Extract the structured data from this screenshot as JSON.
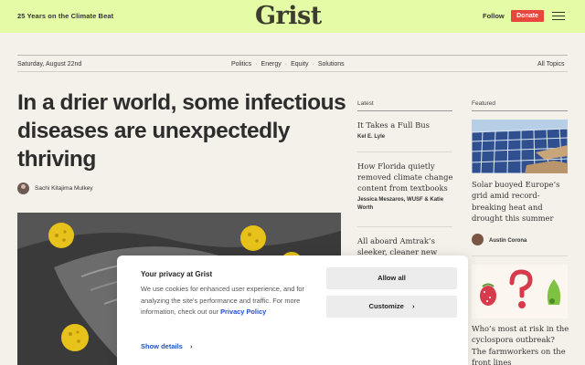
{
  "header": {
    "tagline": "25 Years on the Climate Beat",
    "logo": "Grist",
    "follow": "Follow",
    "donate": "Donate",
    "menu_icon": "hamburger-icon",
    "bg_color": "#e5fca6",
    "donate_color": "#e8473e"
  },
  "nav": {
    "date": "Saturday, August 22nd",
    "topics": [
      "Politics",
      "Energy",
      "Equity",
      "Solutions"
    ],
    "all_topics": "All Topics"
  },
  "article": {
    "headline": "In a drier world, some infectious diseases are unexpectedly thriving",
    "author": "Sachi Kitajima Mulkey"
  },
  "latest": {
    "heading": "Latest",
    "items": [
      {
        "title": "It Takes a Full Bus",
        "byline": "Kel E. Lyle"
      },
      {
        "title": "How Florida quietly removed climate change content from textbooks",
        "byline": "Jessica Meszaros, WUSF & Katie Worth"
      },
      {
        "title": "All aboard Amtrak’s sleeker, cleaner new",
        "byline": ""
      }
    ]
  },
  "featured": {
    "heading": "Featured",
    "items": [
      {
        "title": "Solar buoyed Europe’s grid amid record-breaking heat and drought this summer",
        "author": "Austin Corona"
      },
      {
        "title": "Who’s most at risk in the cyclospora outbreak? The farmworkers on the front lines",
        "author": ""
      }
    ]
  },
  "cookie": {
    "title": "Your privacy at Grist",
    "body": "We use cookies for enhanced user experience, and for analyzing the site's performance and traffic. For more information, check out our ",
    "policy_link": "Privacy Policy",
    "allow": "Allow all",
    "customize": "Customize",
    "show_details": "Show details",
    "link_color": "#2050c8"
  }
}
